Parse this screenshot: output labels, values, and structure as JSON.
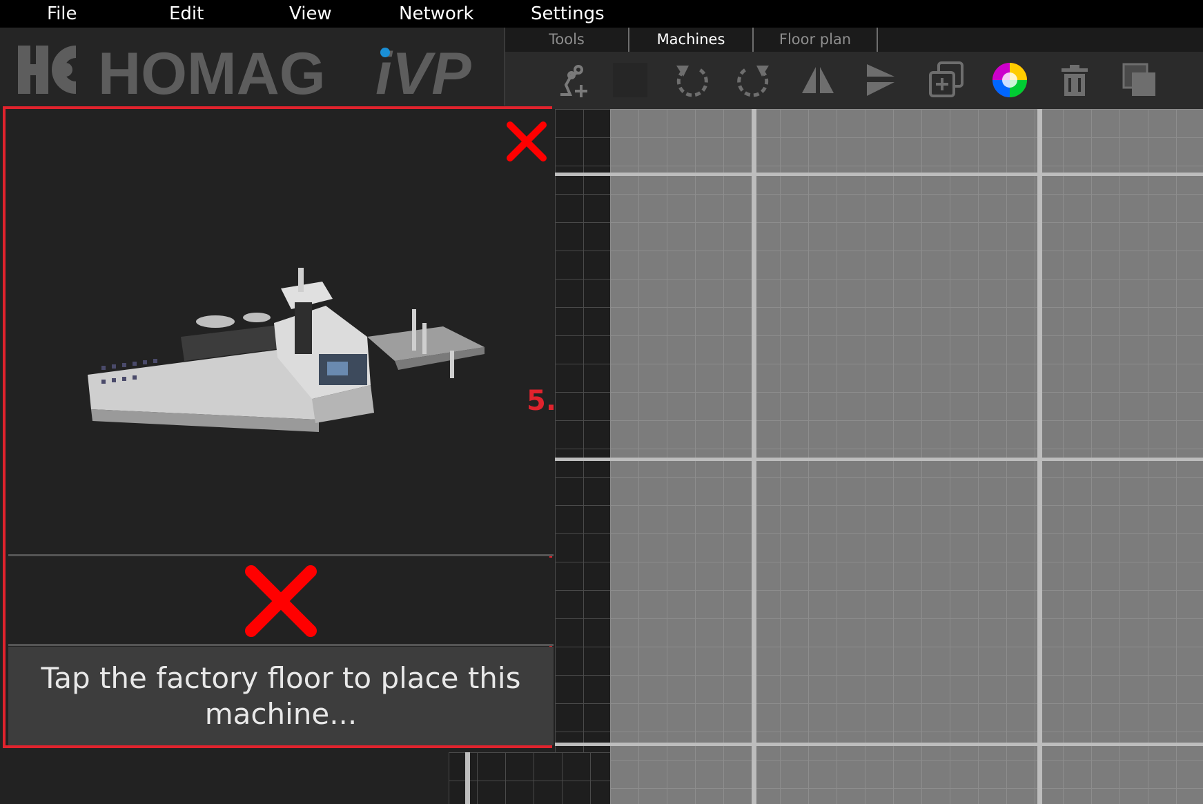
{
  "menu": {
    "file": "File",
    "edit": "Edit",
    "view": "View",
    "network": "Network",
    "settings": "Settings"
  },
  "logo": {
    "brand": "HOMAG",
    "product": "iVP",
    "mark": "HC"
  },
  "tabs": [
    {
      "label": "Tools",
      "active": false
    },
    {
      "label": "Machines",
      "active": true
    },
    {
      "label": "Floor plan",
      "active": false
    }
  ],
  "toolbar": {
    "icons": [
      "add-machine-icon",
      "blank-slot-icon",
      "rotate-left-icon",
      "rotate-right-icon",
      "mirror-horizontal-icon",
      "mirror-vertical-icon",
      "duplicate-icon",
      "color-wheel-icon",
      "trash-icon",
      "layers-icon"
    ]
  },
  "dialog": {
    "message": "Tap the factory floor to place this machine...",
    "annotation": "5.",
    "accent_color": "#e0232d"
  },
  "colors": {
    "menubar": "#000000",
    "background": "#222222",
    "floor": "#7c7c7c",
    "annotation_red": "#e0232d"
  }
}
